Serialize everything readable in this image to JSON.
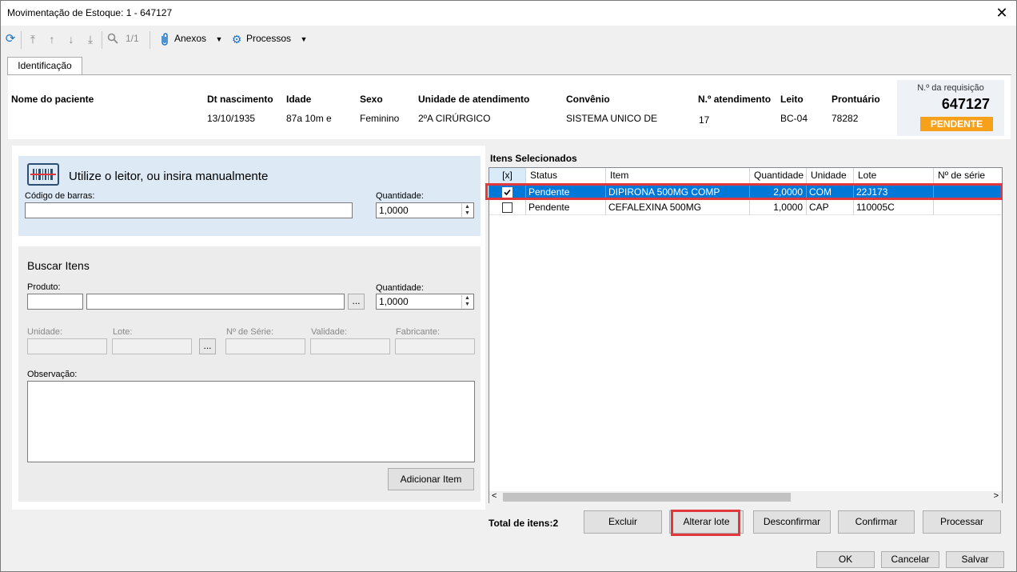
{
  "window": {
    "title": "Movimentação de Estoque: 1 - 647127",
    "close": "✕"
  },
  "toolbar": {
    "counter": "1/1",
    "anexos": "Anexos",
    "processos": "Processos"
  },
  "tab": {
    "label": "Identificação"
  },
  "patient": {
    "labels": {
      "nome": "Nome do paciente",
      "dt": "Dt nascimento",
      "idade": "Idade",
      "sexo": "Sexo",
      "unidade": "Unidade de atendimento",
      "convenio": "Convênio",
      "atend": "N.º atendimento",
      "leito": "Leito",
      "prontuario": "Prontuário"
    },
    "values": {
      "dt": "13/10/1935",
      "idade": "87a 10m  e",
      "sexo": "Feminino",
      "unidade": "2ºA CIRÚRGICO",
      "convenio": "SISTEMA UNICO DE",
      "atend": "17",
      "leito": "BC-04",
      "prontuario": "78282"
    }
  },
  "requisicao": {
    "label": "N.º da requisição",
    "numero": "647127",
    "status": "PENDENTE",
    "status_color": "#f7a11a"
  },
  "scan": {
    "heading": "Utilize o leitor, ou insira manualmente",
    "barcode_label": "Código de barras:",
    "qty_label": "Quantidade:",
    "qty_value": "1,0000"
  },
  "search": {
    "heading": "Buscar Itens",
    "produto_label": "Produto:",
    "qty_label": "Quantidade:",
    "qty_value": "1,0000",
    "unidade_label": "Unidade:",
    "lote_label": "Lote:",
    "serie_label": "Nº de Série:",
    "validade_label": "Validade:",
    "fabricante_label": "Fabricante:",
    "obs_label": "Observação:",
    "dots": "...",
    "add_button": "Adicionar Item"
  },
  "items": {
    "heading": "Itens Selecionados",
    "columns": [
      "[x]",
      "Status",
      "Item",
      "Quantidade",
      "Unidade",
      "Lote",
      "Nº de série"
    ],
    "rows": [
      {
        "checked": true,
        "status": "Pendente",
        "item": "DIPIRONA 500MG COMP",
        "quantidade": "2,0000",
        "unidade": "COM",
        "lote": "22J173",
        "serie": ""
      },
      {
        "checked": false,
        "status": "Pendente",
        "item": "CEFALEXINA 500MG",
        "quantidade": "1,0000",
        "unidade": "CAP",
        "lote": "110005C",
        "serie": ""
      }
    ],
    "total": "Total de itens:2"
  },
  "actions": {
    "excluir": "Excluir",
    "alterar": "Alterar lote",
    "desconfirmar": "Desconfirmar",
    "confirmar": "Confirmar",
    "processar": "Processar"
  },
  "footer": {
    "ok": "OK",
    "cancelar": "Cancelar",
    "salvar": "Salvar"
  },
  "colors": {
    "selection": "#0078d7",
    "highlight": "#e2383c",
    "scan_panel": "#ddeaf6"
  }
}
